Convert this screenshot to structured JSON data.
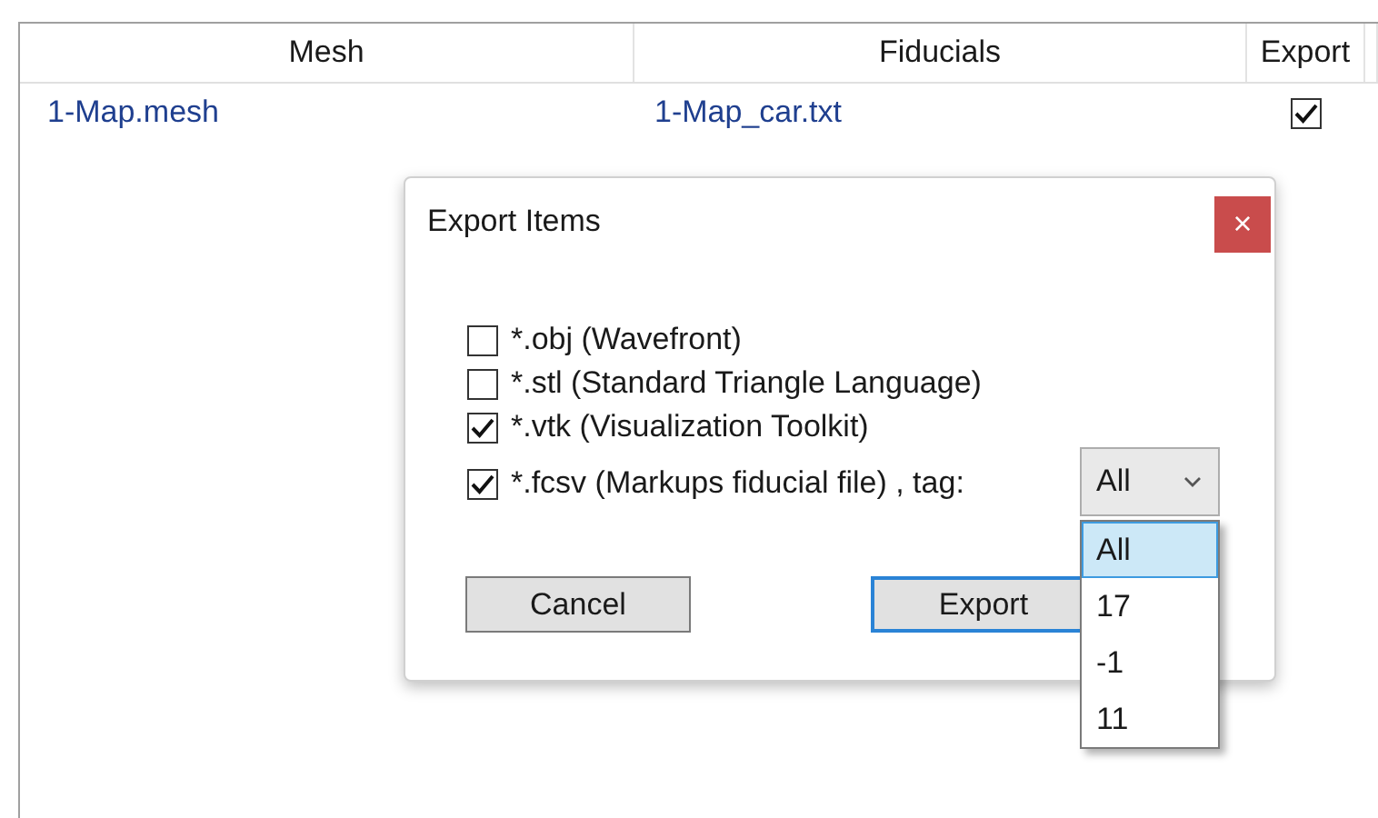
{
  "table": {
    "columns": [
      "Mesh",
      "Fiducials",
      "Export"
    ],
    "rows": [
      {
        "mesh": "1-Map.mesh",
        "fiducials": "1-Map_car.txt",
        "export": true
      }
    ]
  },
  "dialog": {
    "title": "Export Items",
    "close": "×",
    "options": [
      {
        "kind": "plain",
        "label": "*.obj (Wavefront)",
        "checked": false
      },
      {
        "kind": "plain",
        "label": "*.stl (Standard Triangle Language)",
        "checked": false
      },
      {
        "kind": "plain",
        "label": "*.vtk (Visualization Toolkit)",
        "checked": true
      },
      {
        "kind": "tagged",
        "label": "*.fcsv (Markups fiducial file) , tag:",
        "checked": true
      }
    ],
    "tag_select": {
      "value": "All",
      "open": true,
      "options": [
        {
          "label": "All",
          "selected": true
        },
        {
          "label": "17",
          "selected": false
        },
        {
          "label": "-1",
          "selected": false
        },
        {
          "label": "11",
          "selected": false
        }
      ]
    },
    "buttons": [
      {
        "label": "Cancel",
        "focused": false
      },
      {
        "label": "Export",
        "focused": true
      }
    ]
  }
}
